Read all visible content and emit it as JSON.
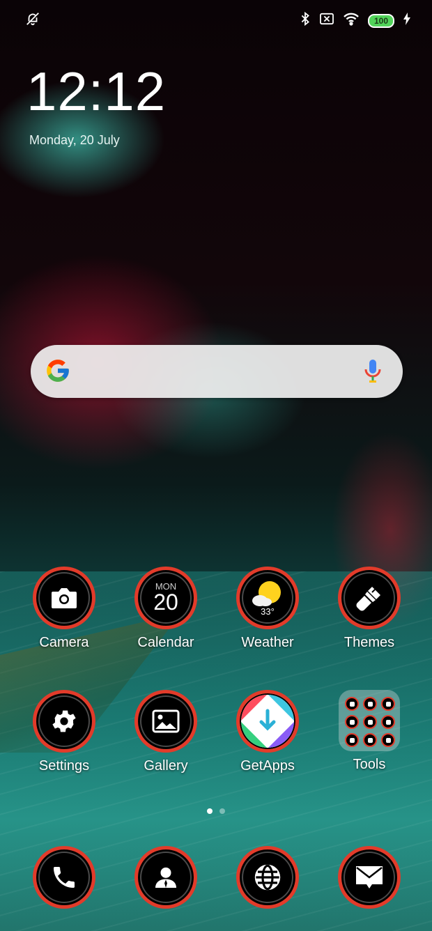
{
  "status_bar": {
    "left_icons": [
      "notifications-muted-icon"
    ],
    "right_icons": [
      "bluetooth-icon",
      "no-sim-icon",
      "wifi-icon"
    ],
    "battery_level": "100",
    "charging_icon": "lightning-icon"
  },
  "clock": {
    "time": "12:12",
    "date": "Monday, 20 July"
  },
  "search": {
    "logo_icon": "google-g-icon",
    "mic_icon": "microphone-icon"
  },
  "apps": [
    {
      "label": "Camera",
      "icon": "camera-icon"
    },
    {
      "label": "Calendar",
      "icon": "calendar-icon",
      "day": "MON",
      "date": "20"
    },
    {
      "label": "Weather",
      "icon": "weather-icon",
      "temp": "33°"
    },
    {
      "label": "Themes",
      "icon": "brush-icon"
    },
    {
      "label": "Settings",
      "icon": "gear-icon"
    },
    {
      "label": "Gallery",
      "icon": "image-icon"
    },
    {
      "label": "GetApps",
      "icon": "getapps-icon"
    },
    {
      "label": "Tools",
      "icon": "folder-icon"
    }
  ],
  "dock": [
    {
      "icon": "phone-icon"
    },
    {
      "icon": "contacts-icon"
    },
    {
      "icon": "browser-globe-icon"
    },
    {
      "icon": "messages-icon"
    }
  ],
  "page_indicator": {
    "pages": 2,
    "current": 1
  },
  "colors": {
    "ring": "#e23b2a",
    "battery": "#52d45a"
  }
}
